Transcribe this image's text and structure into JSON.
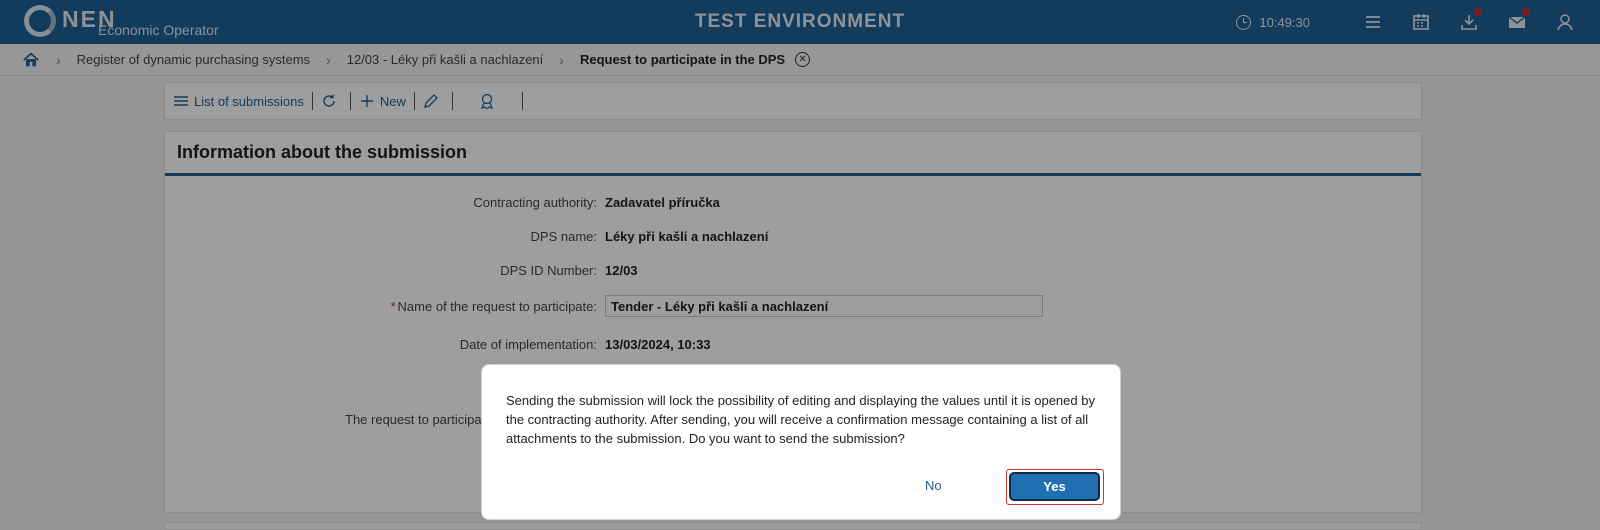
{
  "header": {
    "logo_text": "NEN",
    "logo_subtitle": "Economic Operator",
    "environment": "TEST ENVIRONMENT",
    "time": "10:49:30"
  },
  "breadcrumb": {
    "items": [
      "Register of dynamic purchasing systems",
      "12/03 - Léky při kašli a nachlazení"
    ],
    "current": "Request to participate in the DPS"
  },
  "toolbar": {
    "list_label": "List of submissions",
    "new_label": "New"
  },
  "panel": {
    "title": "Information about the submission",
    "fields": {
      "contracting_authority": {
        "label": "Contracting authority:",
        "value": "Zadavatel příručka"
      },
      "dps_name": {
        "label": "DPS name:",
        "value": "Léky při kašli a nachlazení"
      },
      "dps_id": {
        "label": "DPS ID Number:",
        "value": "12/03"
      },
      "request_name": {
        "label": "Name of the request to participate:",
        "value": "Tender - Léky při kašli a nachlazení"
      },
      "date_impl": {
        "label": "Date of implementation:",
        "value": "13/03/2024, 10:33"
      }
    },
    "partial_label": "The request to participat"
  },
  "dialog": {
    "message": "Sending the submission will lock the possibility of editing and displaying the values until it is opened by the contracting authority. After sending, you will receive a confirmation message containing a list of all attachments to the submission. Do you want to send the submission?",
    "no_label": "No",
    "yes_label": "Yes"
  },
  "colors": {
    "brand": "#1f5f95",
    "primary_button": "#1f6fb2",
    "badge": "#d62c2c"
  },
  "icons": [
    "clock-icon",
    "menu-icon",
    "calendar-icon",
    "download-icon",
    "mail-icon",
    "user-icon",
    "home-icon",
    "close-icon",
    "list-icon",
    "refresh-icon",
    "plus-icon",
    "pencil-icon",
    "award-icon"
  ]
}
